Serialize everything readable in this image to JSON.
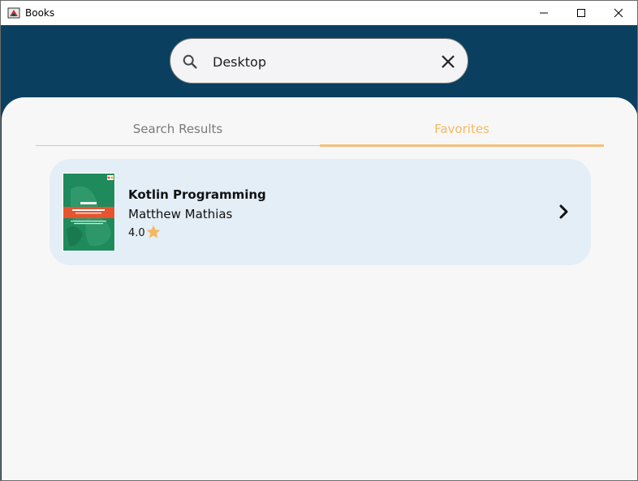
{
  "window": {
    "title": "Books",
    "icons": {
      "app": "books-app-icon",
      "minimize": "minimize-icon",
      "maximize": "maximize-icon",
      "close": "close-icon"
    }
  },
  "search": {
    "value": "Desktop",
    "icon": "search-icon",
    "clear_icon": "clear-icon"
  },
  "tabs": [
    {
      "label": "Search Results",
      "selected": false
    },
    {
      "label": "Favorites",
      "selected": true
    }
  ],
  "favorites": [
    {
      "title": "Kotlin Programming",
      "author": "Matthew Mathias",
      "rating": "4.0",
      "rating_icon": "star-icon",
      "action_icon": "chevron-right-icon"
    }
  ],
  "colors": {
    "header_bg": "#0b3f5f",
    "sheet_bg": "#f7f7f7",
    "card_bg": "#e3eef7",
    "accent": "#f5b860",
    "star": "#f5b860"
  }
}
